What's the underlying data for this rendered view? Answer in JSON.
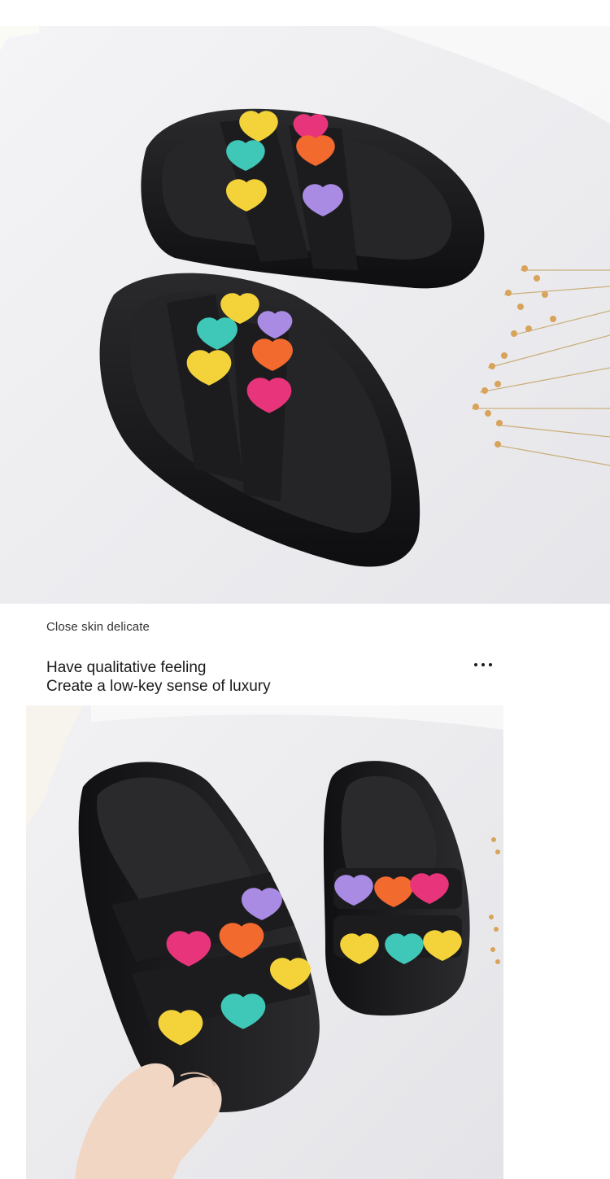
{
  "photos": {
    "top": {
      "subject": "pair-of-black-platform-slides-with-colorful-hearts"
    },
    "bottom": {
      "subject": "hand-holding-black-heart-slides"
    }
  },
  "text": {
    "caption": "Close skin delicate",
    "headline_line1": "Have qualitative feeling",
    "headline_line2": "Create a low-key sense of luxury"
  },
  "icons": {
    "more": "more-dots-icon"
  },
  "colors": {
    "heart_yellow": "#f4d33a",
    "heart_teal": "#3fc8b8",
    "heart_orange": "#f26a2e",
    "heart_pink": "#e8347a",
    "heart_purple": "#a98be3",
    "slide_black": "#1c1c1e"
  }
}
